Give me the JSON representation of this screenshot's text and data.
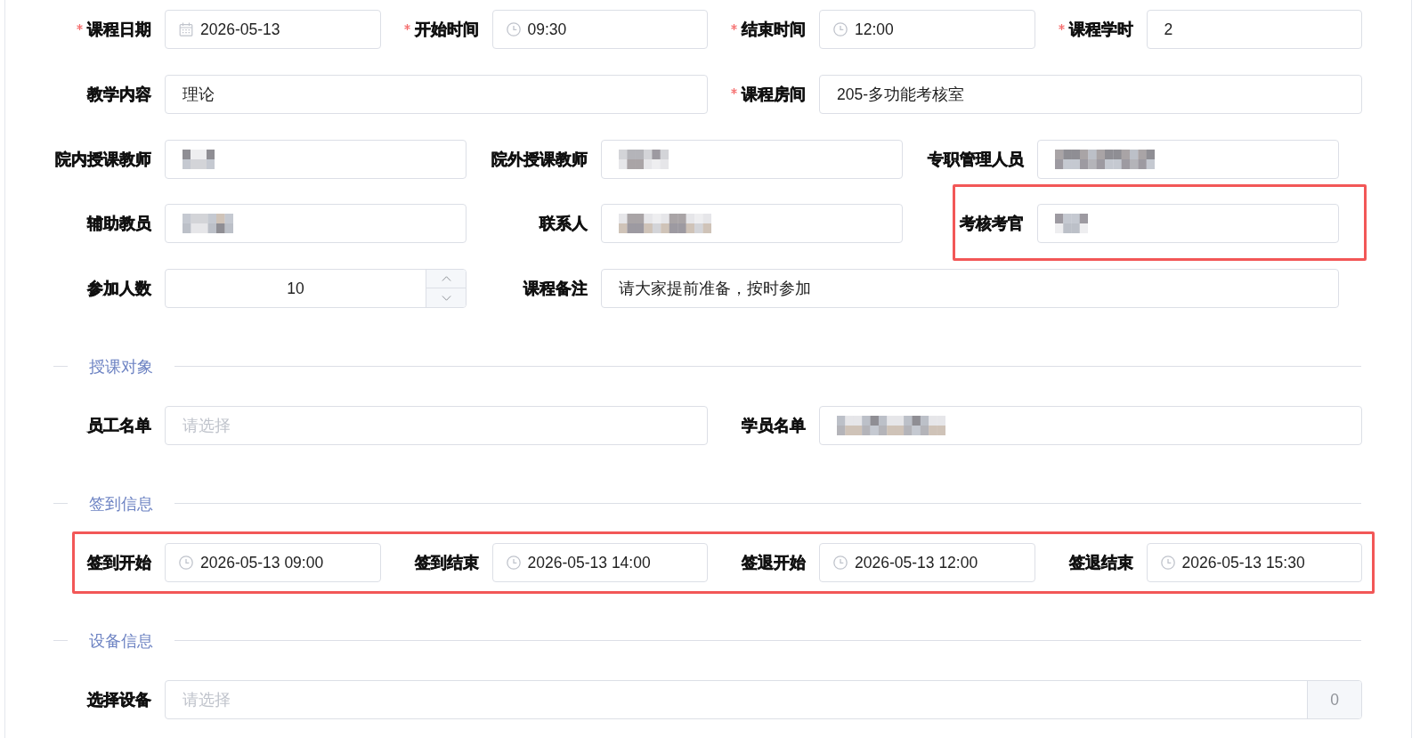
{
  "sections": [
    {
      "rows": [
        {
          "kind": "four",
          "highlighted": false,
          "fields": [
            {
              "label": "课程日期",
              "required": true,
              "highlighted": false,
              "kind": "date",
              "value": "2026-05-13"
            },
            {
              "label": "开始时间",
              "required": true,
              "highlighted": false,
              "kind": "time",
              "value": "09:30"
            },
            {
              "label": "结束时间",
              "required": true,
              "highlighted": false,
              "kind": "time",
              "value": "12:00"
            },
            {
              "label": "课程学时",
              "required": true,
              "highlighted": false,
              "kind": "text",
              "value": "2"
            }
          ]
        },
        {
          "kind": "halves",
          "highlighted": false,
          "fields": [
            {
              "label": "教学内容",
              "required": false,
              "highlighted": false,
              "kind": "text",
              "value": "理论"
            },
            {
              "label": "课程房间",
              "required": true,
              "highlighted": false,
              "kind": "text",
              "value": "205-多功能考核室"
            }
          ]
        },
        {
          "kind": "three",
          "highlighted": false,
          "fields": [
            {
              "label": "院内授课教师",
              "required": false,
              "highlighted": false,
              "kind": "text",
              "redacted": true
            },
            {
              "label": "院外授课教师",
              "required": false,
              "highlighted": false,
              "kind": "text",
              "redacted": true
            },
            {
              "label": "专职管理人员",
              "required": false,
              "highlighted": false,
              "kind": "text",
              "redacted": true
            }
          ]
        },
        {
          "kind": "three",
          "highlighted": false,
          "fields": [
            {
              "label": "辅助教员",
              "required": false,
              "highlighted": false,
              "kind": "text",
              "redacted": true
            },
            {
              "label": "联系人",
              "required": false,
              "highlighted": false,
              "kind": "text",
              "redacted": true
            },
            {
              "label": "考核考官",
              "required": false,
              "highlighted": true,
              "kind": "text",
              "redacted": true
            }
          ]
        },
        {
          "kind": "one_two",
          "highlighted": false,
          "fields": [
            {
              "label": "参加人数",
              "required": false,
              "highlighted": false,
              "kind": "number",
              "value": "10"
            },
            {
              "label": "课程备注",
              "required": false,
              "highlighted": false,
              "kind": "text",
              "value": "请大家提前准备，按时参加"
            }
          ]
        }
      ]
    },
    {
      "title": "授课对象",
      "rows": [
        {
          "kind": "halves",
          "highlighted": false,
          "fields": [
            {
              "label": "员工名单",
              "required": false,
              "highlighted": false,
              "kind": "select",
              "placeholder": "请选择"
            },
            {
              "label": "学员名单",
              "required": false,
              "highlighted": false,
              "kind": "select",
              "redacted": true
            }
          ]
        }
      ]
    },
    {
      "title": "签到信息",
      "rows": [
        {
          "kind": "four",
          "highlighted": true,
          "fields": [
            {
              "label": "签到开始",
              "required": false,
              "highlighted": false,
              "kind": "datetime",
              "value": "2026-05-13 09:00"
            },
            {
              "label": "签到结束",
              "required": false,
              "highlighted": false,
              "kind": "datetime",
              "value": "2026-05-13 14:00"
            },
            {
              "label": "签退开始",
              "required": false,
              "highlighted": false,
              "kind": "datetime",
              "value": "2026-05-13 12:00"
            },
            {
              "label": "签退结束",
              "required": false,
              "highlighted": false,
              "kind": "datetime",
              "value": "2026-05-13 15:30"
            }
          ]
        }
      ]
    },
    {
      "title": "设备信息",
      "rows": [
        {
          "kind": "full",
          "highlighted": false,
          "fields": [
            {
              "label": "选择设备",
              "required": false,
              "highlighted": false,
              "kind": "select_count",
              "placeholder": "请选择",
              "count": "0"
            }
          ]
        }
      ]
    }
  ]
}
